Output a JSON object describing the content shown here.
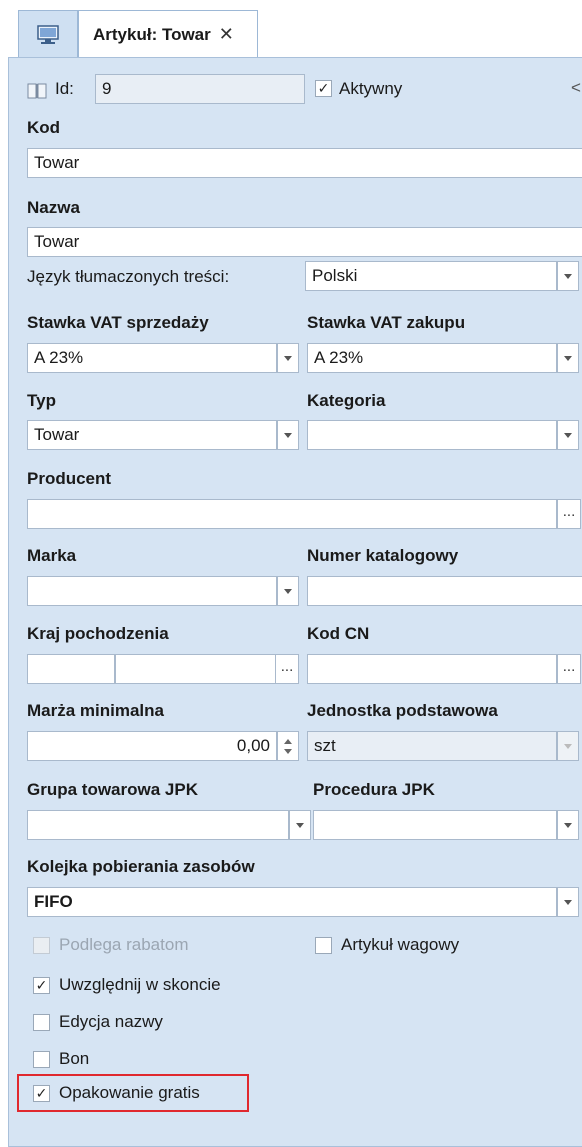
{
  "tab": {
    "icon": "desktop-icon",
    "title": "Artykuł: Towar",
    "close": "✕"
  },
  "header": {
    "id_label": "Id:",
    "id_value": "9",
    "active_label": "Aktywny",
    "active_checked": true,
    "collapse_glyph": "<"
  },
  "kod": {
    "label": "Kod",
    "value": "Towar"
  },
  "nazwa": {
    "label": "Nazwa",
    "value": "Towar"
  },
  "jezyk": {
    "label": "Język tłumaczonych treści:",
    "value": "Polski"
  },
  "vat_sprzedazy": {
    "label": "Stawka VAT sprzedaży",
    "value": "A 23%"
  },
  "vat_zakupu": {
    "label": "Stawka VAT zakupu",
    "value": "A 23%"
  },
  "typ": {
    "label": "Typ",
    "value": "Towar"
  },
  "kategoria": {
    "label": "Kategoria",
    "value": ""
  },
  "producent": {
    "label": "Producent",
    "value": "",
    "button": "..."
  },
  "marka": {
    "label": "Marka",
    "value": ""
  },
  "numer_katalogowy": {
    "label": "Numer katalogowy",
    "value": ""
  },
  "kraj_pochodzenia": {
    "label": "Kraj pochodzenia",
    "code": "",
    "name": "",
    "button": "..."
  },
  "kod_cn": {
    "label": "Kod CN",
    "value": "",
    "button": "..."
  },
  "marza": {
    "label": "Marża minimalna",
    "value": "0,00"
  },
  "jednostka": {
    "label": "Jednostka podstawowa",
    "value": "szt"
  },
  "grupa_jpk": {
    "label": "Grupa towarowa JPK",
    "value": ""
  },
  "procedura_jpk": {
    "label": "Procedura JPK",
    "value": ""
  },
  "kolejka": {
    "label": "Kolejka pobierania zasobów",
    "value": "FIFO"
  },
  "checkboxes": {
    "podlega_rabatom": {
      "label": "Podlega rabatom",
      "checked": false,
      "disabled": true
    },
    "artykul_wagowy": {
      "label": "Artykuł wagowy",
      "checked": false,
      "disabled": false
    },
    "uwzglednij_w_skoncie": {
      "label": "Uwzględnij w skoncie",
      "checked": true,
      "disabled": false
    },
    "edycja_nazwy": {
      "label": "Edycja nazwy",
      "checked": false,
      "disabled": false
    },
    "bon": {
      "label": "Bon",
      "checked": false,
      "disabled": false
    },
    "opakowanie_gratis": {
      "label": "Opakowanie gratis",
      "checked": true,
      "disabled": false
    }
  },
  "check_glyph": "✓",
  "colors": {
    "panel_bg": "#d6e4f3",
    "highlight": "#e0282e",
    "field_border": "#a9b9cc"
  }
}
